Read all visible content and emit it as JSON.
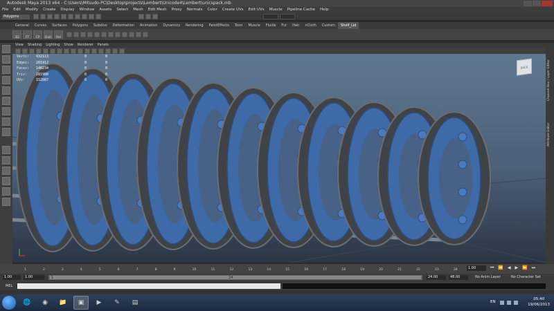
{
  "window": {
    "title": "Autodesk Maya 2013 x64 - C:\\Users\\Mitsudo-PC\\Desktop\\projects\\Lembert\\Unicode4\\Lembert\\unicspack.mb"
  },
  "menubar": {
    "items": [
      "File",
      "Edit",
      "Modify",
      "Create",
      "Display",
      "Window",
      "Assets",
      "Select",
      "Mesh",
      "Edit Mesh",
      "Proxy",
      "Normals",
      "Color",
      "Create UVs",
      "Edit UVs",
      "Muscle",
      "Pipeline Cache",
      "Help"
    ]
  },
  "status_line": {
    "mode": "Polygons"
  },
  "shelf": {
    "tabs": [
      "General",
      "Curves",
      "Surfaces",
      "Polygons",
      "Subdivs",
      "Deformation",
      "Animation",
      "Dynamics",
      "Rendering",
      "PaintEffects",
      "Toon",
      "Muscle",
      "Fluids",
      "Fur",
      "Hair",
      "nCloth",
      "Custom",
      "Shelf_Lid"
    ],
    "active_tab": "Shelf_Lid",
    "icons": [
      "3D",
      "FT",
      "CP",
      "Outl",
      "Rel"
    ]
  },
  "panel_menu": {
    "items": [
      "View",
      "Shading",
      "Lighting",
      "Show",
      "Renderer",
      "Panels"
    ]
  },
  "hud": {
    "rows": [
      {
        "label": "Verts:",
        "value": "432113",
        "v2": "0",
        "v3": "0"
      },
      {
        "label": "Edges:",
        "value": "281912",
        "v2": "0",
        "v3": "0"
      },
      {
        "label": "Faces:",
        "value": "148234",
        "v2": "0",
        "v3": "0"
      },
      {
        "label": "Tris:",
        "value": "281988",
        "v2": "0",
        "v3": "0"
      },
      {
        "label": "UVs:",
        "value": "152867",
        "v2": "0",
        "v3": "0"
      }
    ]
  },
  "viewcube": {
    "label": "BACK"
  },
  "side_tabs": {
    "items": [
      "Channel Box / Layer Editor",
      "Attribute Editor"
    ]
  },
  "timeline": {
    "ticks": [
      "1",
      "2",
      "3",
      "4",
      "5",
      "6",
      "7",
      "8",
      "9",
      "10",
      "11",
      "12",
      "13",
      "14",
      "15",
      "16",
      "17",
      "18",
      "19",
      "20",
      "21",
      "22",
      "23",
      "24"
    ],
    "current_frame": "1.00"
  },
  "range": {
    "start": "1.00",
    "inner_start": "1.00",
    "handle_start": "1",
    "handle_end": "24",
    "end": "24.00",
    "anim_end": "48.00",
    "anim_layer": "No Anim Layer",
    "char_set": "No Character Set"
  },
  "command_line": {
    "label": "MEL"
  },
  "taskbar": {
    "language": "EN",
    "time": "05:40",
    "date": "19/06/2013"
  },
  "colors": {
    "viewport_top": "#5f7892",
    "viewport_bottom": "#2b3544",
    "model_blue": "#3e6aa8",
    "rim_dark": "#3f4246"
  }
}
